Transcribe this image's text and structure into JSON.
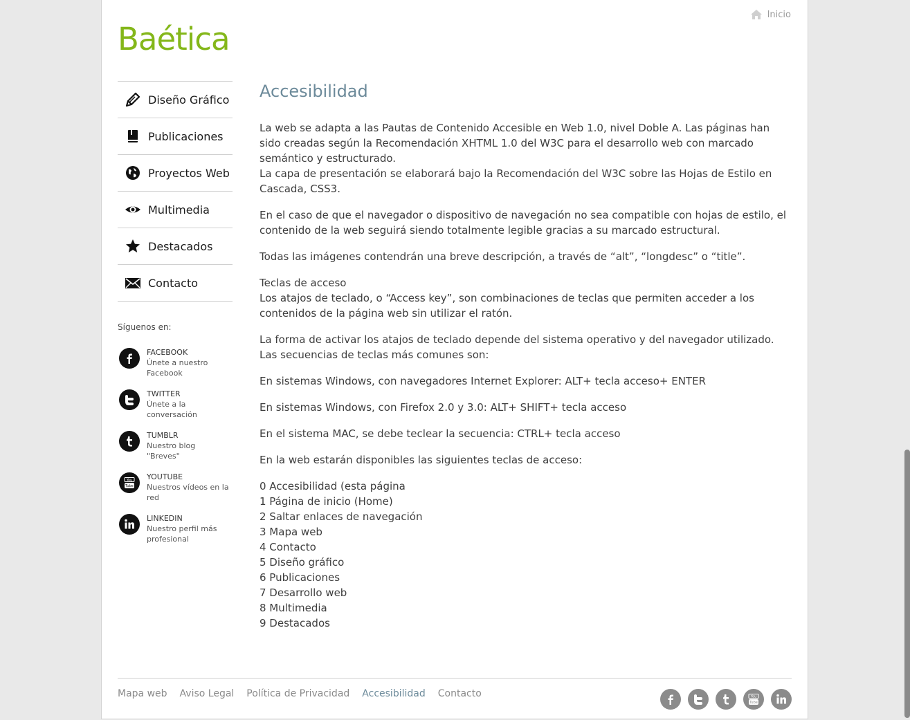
{
  "site": {
    "logo": "Baética",
    "home_label": "Inicio"
  },
  "nav": [
    {
      "label": "Diseño Gráfico",
      "icon": "pencil-icon"
    },
    {
      "label": "Publicaciones",
      "icon": "book-icon"
    },
    {
      "label": "Proyectos Web",
      "icon": "globe-icon"
    },
    {
      "label": "Multimedia",
      "icon": "eye-icon"
    },
    {
      "label": "Destacados",
      "icon": "star-icon"
    },
    {
      "label": "Contacto",
      "icon": "envelope-icon"
    }
  ],
  "follow": {
    "title": "Síguenos en:",
    "items": [
      {
        "name": "FACEBOOK",
        "line1": "Únete a nuestro",
        "line2": "Facebook",
        "icon": "facebook-icon"
      },
      {
        "name": "TWITTER",
        "line1": "Únete a la",
        "line2": "conversación",
        "icon": "twitter-icon"
      },
      {
        "name": "TUMBLR",
        "line1": "Nuestro blog",
        "line2": "\"Breves\"",
        "icon": "tumblr-icon"
      },
      {
        "name": "YOUTUBE",
        "line1": "Nuestros vídeos en la",
        "line2": "red",
        "icon": "youtube-icon"
      },
      {
        "name": "LINKEDIN",
        "line1": "Nuestro perfil más",
        "line2": "profesional",
        "icon": "linkedin-icon"
      }
    ]
  },
  "content": {
    "title": "Accesibilidad",
    "p1": "La web se adapta a las Pautas de Contenido Accesible en Web 1.0, nivel Doble A. Las páginas han sido creadas según la Recomendación XHTML 1.0 del W3C para el desarrollo web con marcado semántico y estructurado.",
    "p1b": "La capa de presentación se elaborará bajo la Recomendación del W3C sobre las Hojas de Estilo en Cascada, CSS3.",
    "p2": "En el caso de que el navegador o dispositivo de navegación no sea compatible con hojas de estilo, el contenido de la web seguirá siendo totalmente legible gracias a su marcado estructural.",
    "p3": "Todas las imágenes contendrán una breve descripción, a través de “alt”, “longdesc” o “title”.",
    "p4_title": "Teclas de acceso",
    "p4": "Los atajos de teclado, o “Access key”, son combinaciones de teclas que permiten acceder a los contenidos de la página web sin utilizar el ratón.",
    "p5": "La forma de activar los atajos de teclado depende del sistema operativo y del navegador utilizado.",
    "p5b": "Las secuencias de teclas más comunes son:",
    "p6": "En sistemas Windows, con navegadores Internet Explorer: ALT+ tecla acceso+ ENTER",
    "p7": "En sistemas Windows, con Firefox 2.0 y 3.0: ALT+ SHIFT+ tecla acceso",
    "p8": "En el sistema MAC, se debe teclear la secuencia: CTRL+ tecla acceso",
    "p9": "En la web estarán disponibles las siguientes teclas de acceso:",
    "keys": [
      "0 Accesibilidad (esta página",
      "1 Página de inicio (Home)",
      "2 Saltar enlaces de navegación",
      "3 Mapa web",
      "4 Contacto",
      "5 Diseño gráfico",
      "6 Publicaciones",
      "7 Desarrollo web",
      "8 Multimedia",
      "9 Destacados"
    ]
  },
  "footer": {
    "links": [
      "Mapa web",
      "Aviso Legal",
      "Política de Privacidad",
      "Accesibilidad",
      "Contacto"
    ],
    "active": "Accesibilidad",
    "icons": [
      "facebook-icon",
      "twitter-icon",
      "tumblr-icon",
      "youtube-icon",
      "linkedin-icon"
    ]
  },
  "colors": {
    "logo": "#84b71a",
    "title": "#6c8a9a",
    "text": "#3e3e3e",
    "footer_icon": "#8b8b8b"
  }
}
